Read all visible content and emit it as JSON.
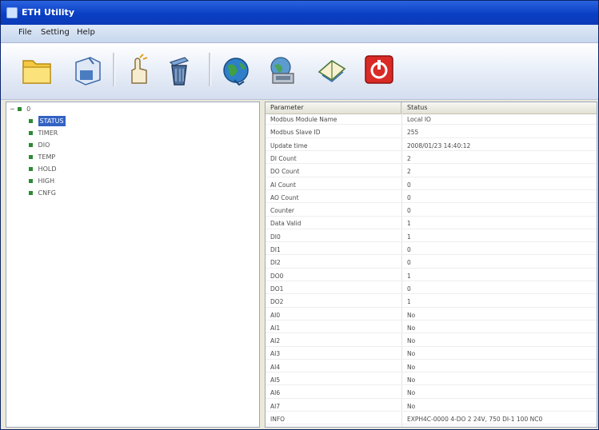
{
  "window": {
    "title": "ETH Utility"
  },
  "menu": {
    "items": [
      "File",
      "Setting",
      "Help"
    ]
  },
  "toolbar": {
    "buttons": [
      {
        "icon": "folder-open-icon"
      },
      {
        "icon": "save-icon"
      },
      {
        "icon": "hand-click-icon"
      },
      {
        "icon": "trash-icon"
      },
      {
        "icon": "globe-icon"
      },
      {
        "icon": "network-computer-icon"
      },
      {
        "icon": "book-icon"
      },
      {
        "icon": "power-icon"
      }
    ]
  },
  "tree": {
    "root": "0",
    "items": [
      {
        "label": "STATUS",
        "selected": true
      },
      {
        "label": "TIMER",
        "selected": false
      },
      {
        "label": "DIO",
        "selected": false
      },
      {
        "label": "TEMP",
        "selected": false
      },
      {
        "label": "HOLD",
        "selected": false
      },
      {
        "label": "HIGH",
        "selected": false
      },
      {
        "label": "CNFG",
        "selected": false
      }
    ]
  },
  "table": {
    "columns": [
      "Parameter",
      "Status"
    ],
    "rows": [
      [
        "Modbus Module Name",
        "Local IO"
      ],
      [
        "Modbus Slave ID",
        "255"
      ],
      [
        "Update time",
        "2008/01/23 14:40:12"
      ],
      [
        "DI Count",
        "2"
      ],
      [
        "DO Count",
        "2"
      ],
      [
        "AI Count",
        "0"
      ],
      [
        "AO Count",
        "0"
      ],
      [
        "Counter",
        "0"
      ],
      [
        "Data Valid",
        "1"
      ],
      [
        "DI0",
        "1"
      ],
      [
        "DI1",
        "0"
      ],
      [
        "DI2",
        "0"
      ],
      [
        "DO0",
        "1"
      ],
      [
        "DO1",
        "0"
      ],
      [
        "DO2",
        "1"
      ],
      [
        "AI0",
        "No"
      ],
      [
        "AI1",
        "No"
      ],
      [
        "AI2",
        "No"
      ],
      [
        "AI3",
        "No"
      ],
      [
        "AI4",
        "No"
      ],
      [
        "AI5",
        "No"
      ],
      [
        "AI6",
        "No"
      ],
      [
        "AI7",
        "No"
      ],
      [
        "INFO",
        "EXPH4C-0000 4-DO 2 24V, 750 DI-1 100 NC0"
      ]
    ]
  }
}
